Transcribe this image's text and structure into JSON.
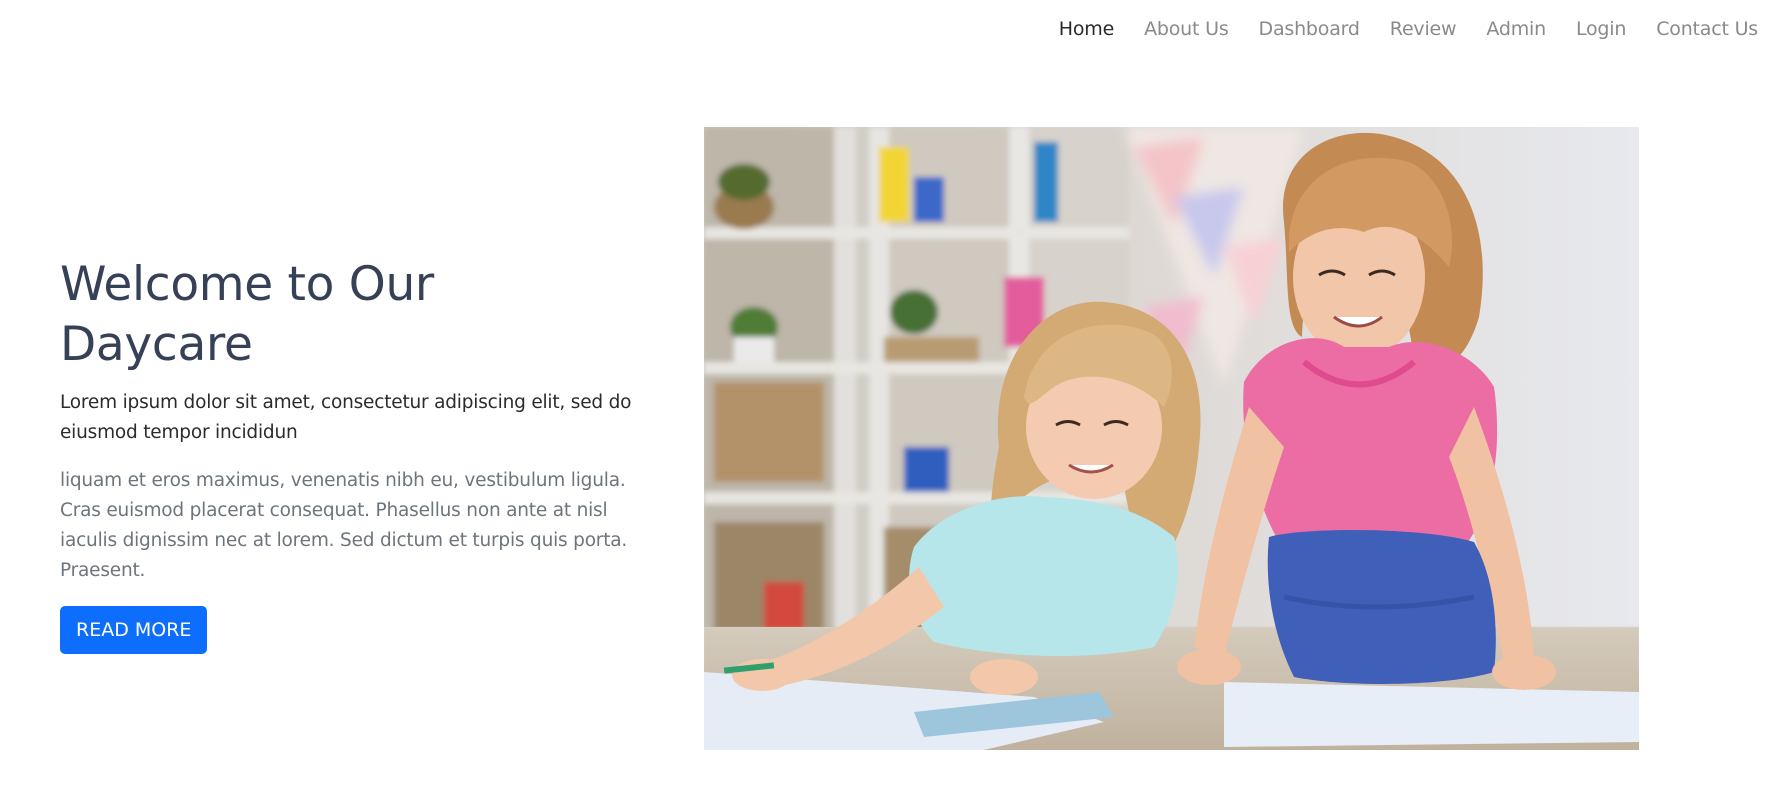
{
  "nav": {
    "items": [
      {
        "label": "Home",
        "active": true
      },
      {
        "label": "About Us",
        "active": false
      },
      {
        "label": "Dashboard",
        "active": false
      },
      {
        "label": "Review",
        "active": false
      },
      {
        "label": "Admin",
        "active": false
      },
      {
        "label": "Login",
        "active": false
      },
      {
        "label": "Contact Us",
        "active": false
      }
    ]
  },
  "hero": {
    "title_line1": "Welcome to Our",
    "title_line2": "Daycare",
    "lead": "Lorem ipsum dolor sit amet, consectetur adipiscing elit, sed do eiusmod tempor incididun",
    "body": "liquam et eros maximus, venenatis nibh eu, vestibulum ligula. Cras euismod placerat consequat. Phasellus non ante at nisl iaculis dignissim nec at lorem. Sed dictum et turpis quis porta. Praesent.",
    "button_label": "READ MORE"
  },
  "colors": {
    "primary": "#0d6efd",
    "heading": "#364056",
    "muted": "#6c757d",
    "nav_inactive": "#8a8a8a",
    "nav_active": "#2a2a2a"
  }
}
